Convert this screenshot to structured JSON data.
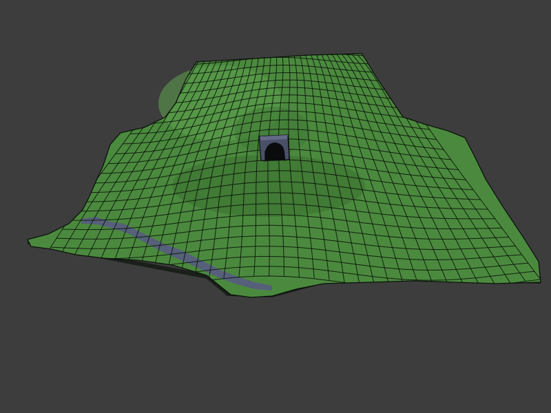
{
  "viewport": {
    "background": "#3d3d3d"
  },
  "terrain": {
    "base_color": "#4b8a3e",
    "light_color": "#5fa34f",
    "dark_color": "#35692b",
    "wire_color": "#0b120a",
    "rock_color": "#56607a",
    "side_color": "#1a1f1a"
  },
  "tunnel": {
    "frame_color": "#4a5068",
    "inner_color": "#0a0b0d"
  }
}
